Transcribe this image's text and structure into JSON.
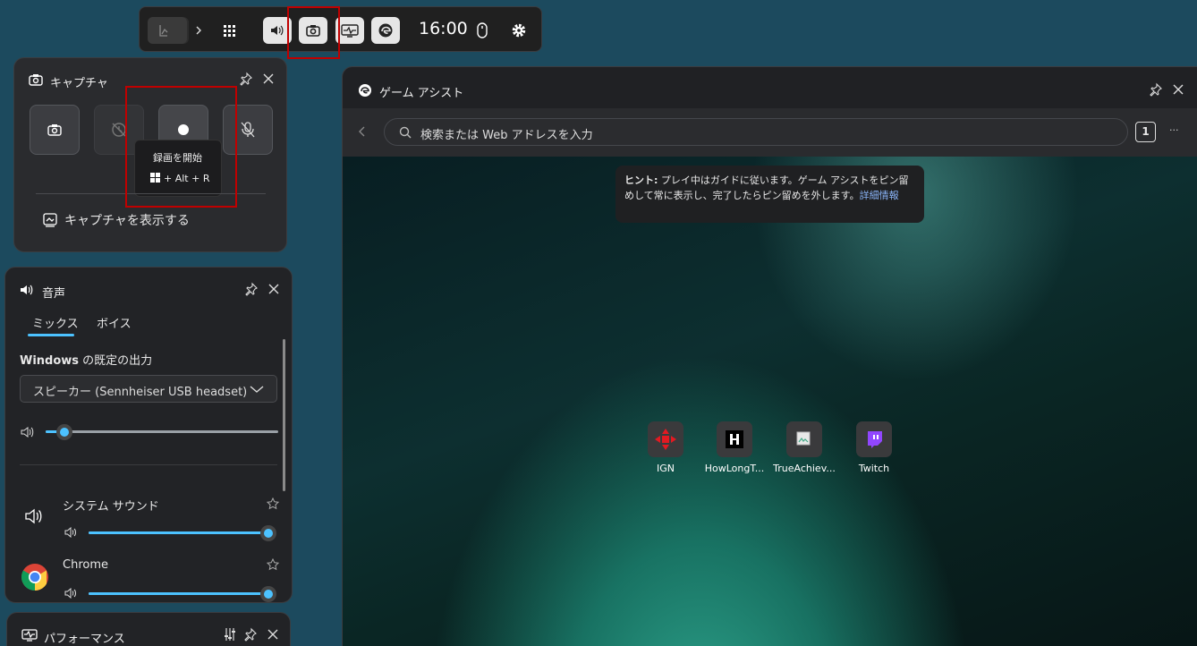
{
  "toolbar": {
    "time": "16:00",
    "highlight_color": "#c00000"
  },
  "capture": {
    "title": "キャプチャ",
    "tooltip": {
      "title": "録画を開始",
      "shortcut": "+ Alt + R"
    },
    "show_captures_label": "キャプチャを表示する"
  },
  "audio": {
    "title": "音声",
    "tabs": [
      {
        "label": "ミックス"
      },
      {
        "label": "ボイス"
      }
    ],
    "output_label_bold": "Windows",
    "output_label_rest": " の既定の出力",
    "device_selected": "スピーカー (Sennheiser USB headset)",
    "master_volume": 0.06,
    "apps": [
      {
        "name": "システム サウンド",
        "volume": 1.0
      },
      {
        "name": "Chrome",
        "volume": 1.0
      }
    ]
  },
  "assist": {
    "title": "ゲーム アシスト",
    "search_placeholder": "検索または Web アドレスを入力",
    "tab_count": "1",
    "more_label": "···",
    "hint_bold": "ヒント:",
    "hint_text": " プレイ中はガイドに従います。ゲーム アシストをピン留めして常に表示し、完了したらピン留めを外します。",
    "hint_link": "詳細情報",
    "tiles": [
      {
        "label": "IGN",
        "color": "#e21a22"
      },
      {
        "label": "HowLongT...",
        "color": "#000000"
      },
      {
        "label": "TrueAchiev...",
        "color": "#3a3a3a"
      },
      {
        "label": "Twitch",
        "color": "#9146ff"
      }
    ]
  },
  "performance": {
    "title": "パフォーマンス"
  },
  "colors": {
    "accent": "#4cc2ff",
    "panel": "#202124",
    "desktop": "#1c4a5e"
  }
}
